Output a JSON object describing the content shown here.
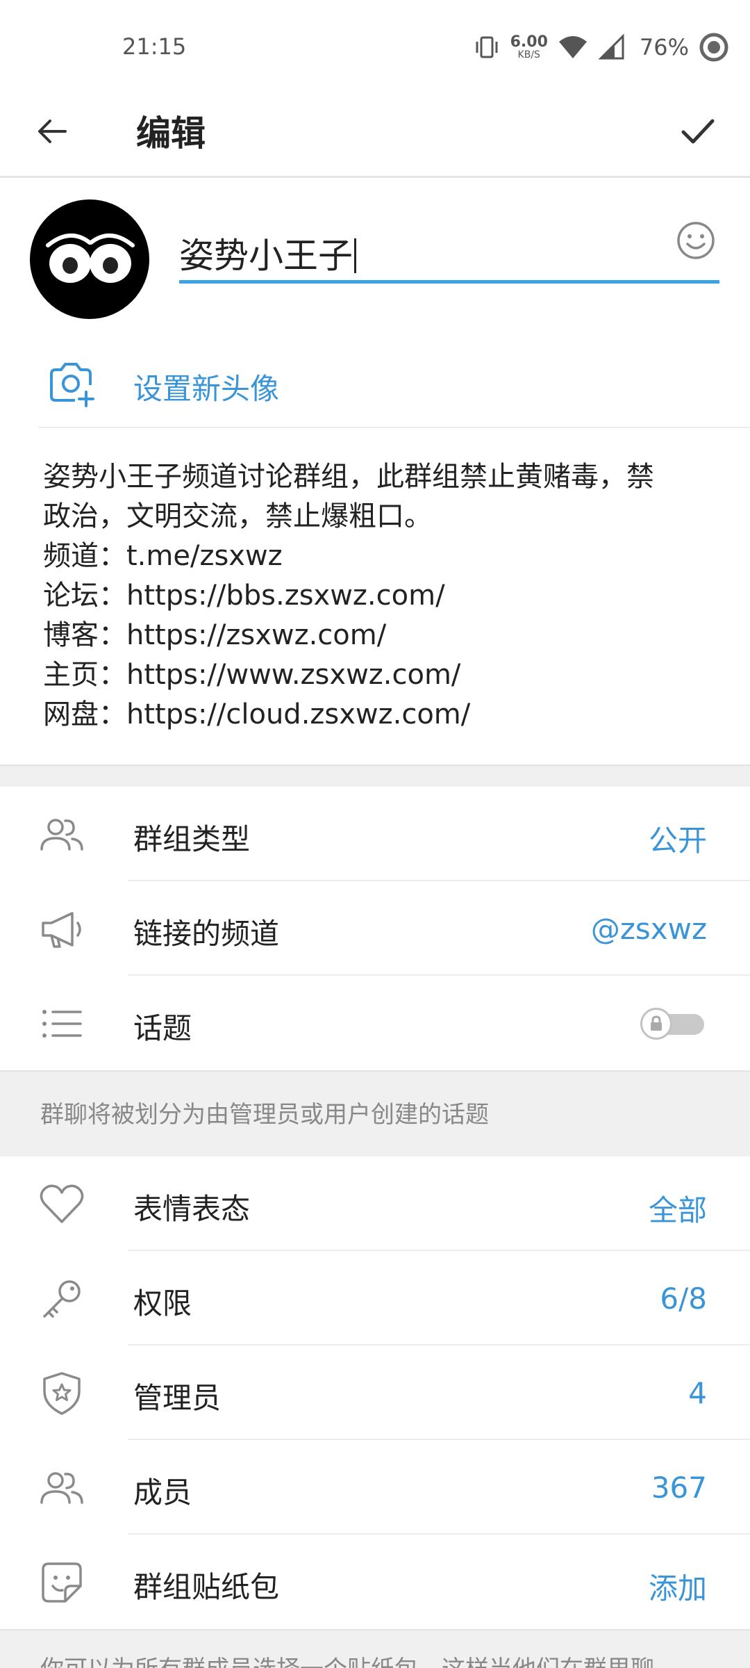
{
  "status_bar": {
    "time": "21:15",
    "net_speed_value": "6.00",
    "net_speed_unit": "KB/S",
    "battery": "76%"
  },
  "app_bar": {
    "title": "编辑",
    "back_icon": "arrow-left-icon",
    "done_icon": "checkmark-icon"
  },
  "profile": {
    "name_value": "姿势小王子",
    "set_photo_label": "设置新头像",
    "description": "姿势小王子频道讨论群组，此群组禁止黄赌毒，禁\n政治，文明交流，禁止爆粗口。\n频道：t.me/zsxwz\n论坛：https://bbs.zsxwz.com/\n博客：https://zsxwz.com/\n主页：https://www.zsxwz.com/\n网盘：https://cloud.zsxwz.com/"
  },
  "settings_group1": [
    {
      "icon": "users-icon",
      "label": "群组类型",
      "value": "公开"
    },
    {
      "icon": "megaphone-icon",
      "label": "链接的频道",
      "value": "@zsxwz"
    },
    {
      "icon": "list-icon",
      "label": "话题",
      "toggle_locked": true,
      "toggle_on": false
    }
  ],
  "hint1": "群聊将被划分为由管理员或用户创建的话题",
  "settings_group2": [
    {
      "icon": "heart-icon",
      "label": "表情表态",
      "value": "全部"
    },
    {
      "icon": "key-icon",
      "label": "权限",
      "value": "6/8"
    },
    {
      "icon": "shield-star-icon",
      "label": "管理员",
      "value": "4"
    },
    {
      "icon": "users-icon",
      "label": "成员",
      "value": "367"
    },
    {
      "icon": "sticker-icon",
      "label": "群组贴纸包",
      "value": "添加"
    }
  ],
  "hint2": "你可以为所有群成员选择一个贴纸包，这样当他们在群里聊",
  "colors": {
    "accent": "#3a95d8",
    "underline": "#3aa3e3",
    "icon_gray": "#8a8a8a",
    "section_bg": "#f0f0f0"
  }
}
